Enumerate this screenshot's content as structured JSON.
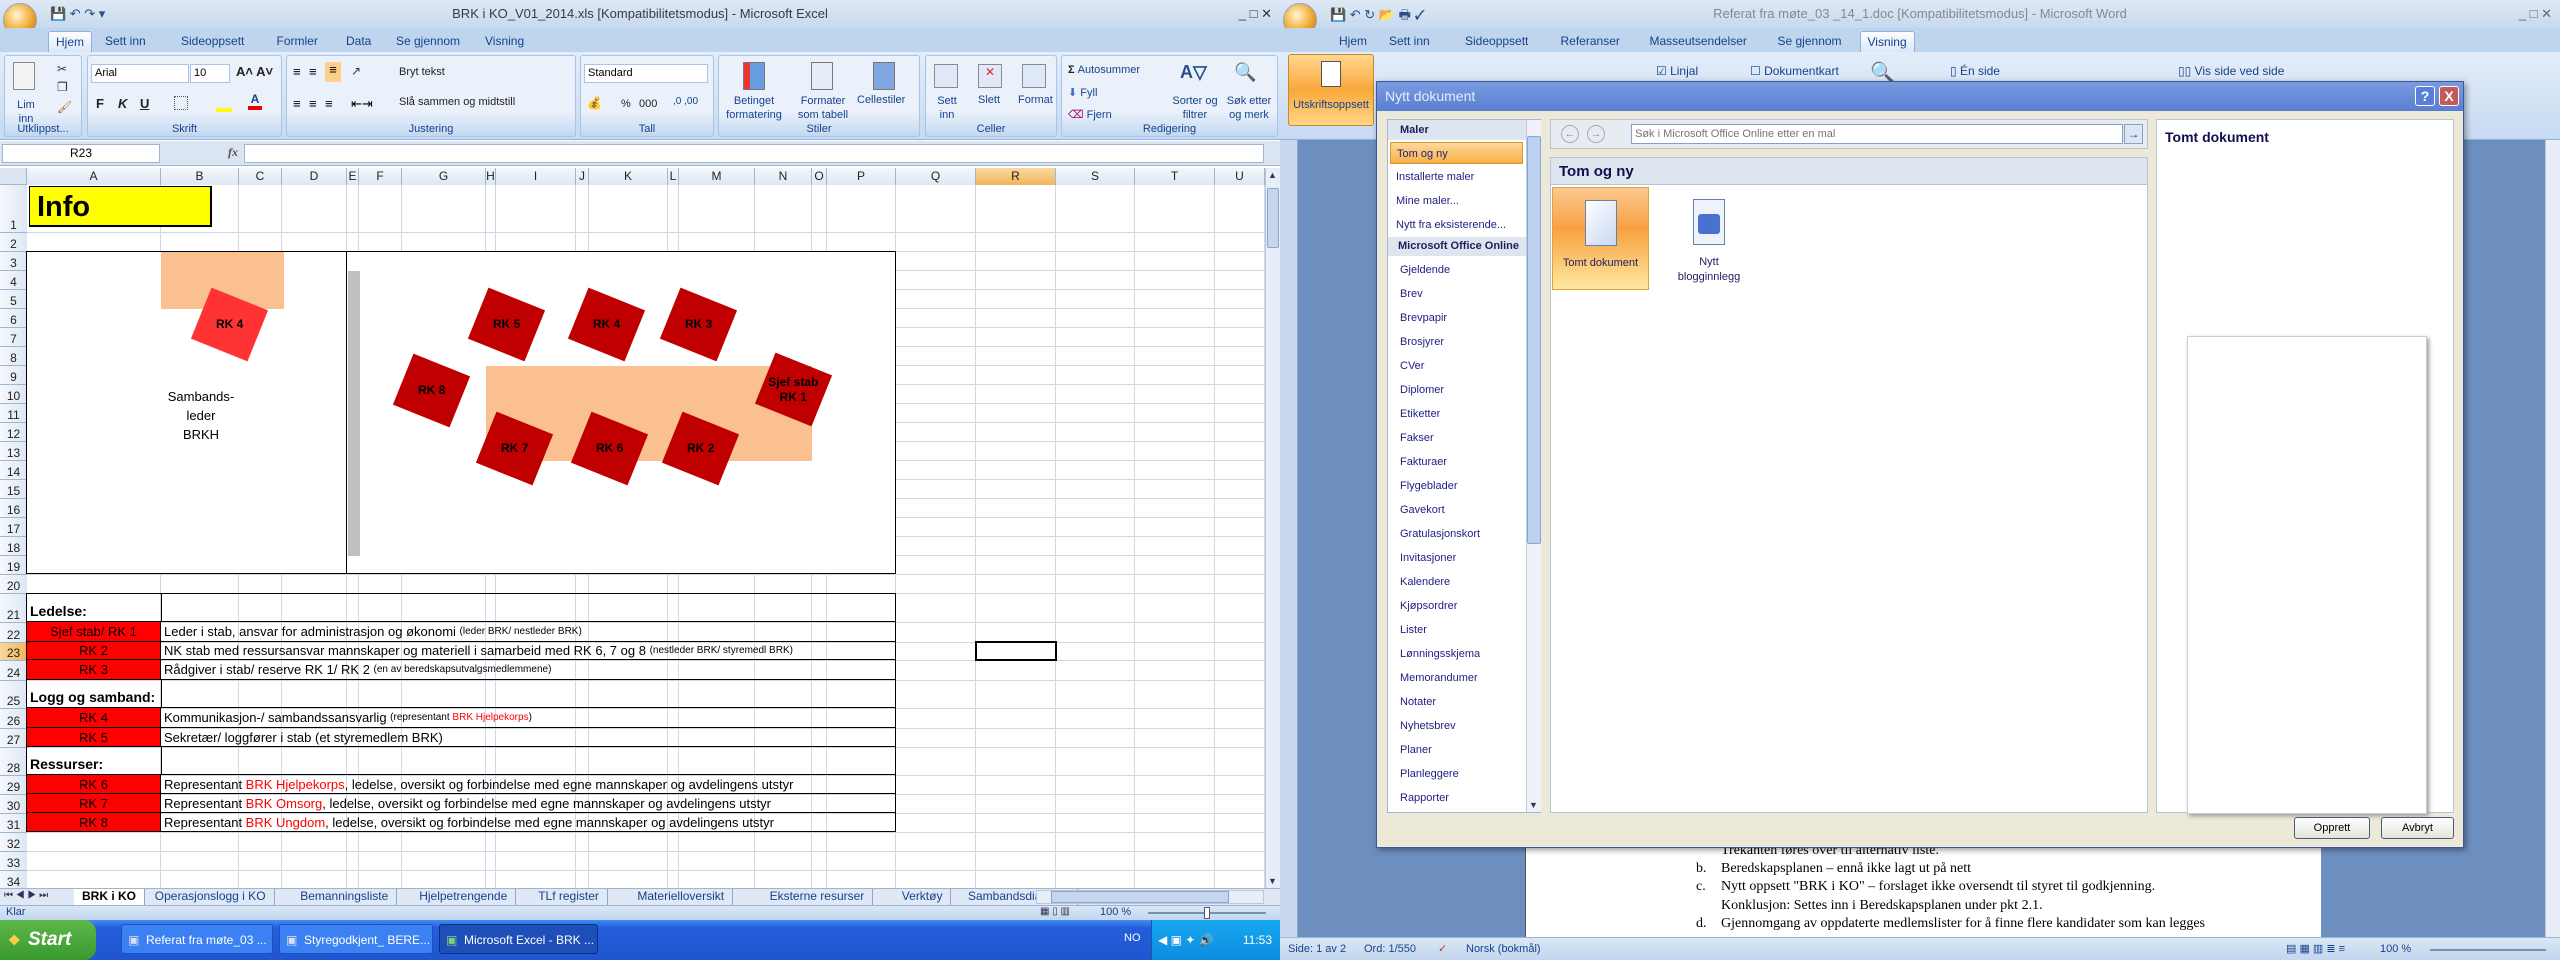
{
  "excel": {
    "title": "BRK i KO_V01_2014.xls  [Kompatibilitetsmodus] - Microsoft Excel",
    "tabs": [
      "Hjem",
      "Sett inn",
      "Sideoppsett",
      "Formler",
      "Data",
      "Se gjennom",
      "Visning"
    ],
    "active_tab": "Hjem",
    "ribbon": {
      "groups": [
        "Utklippst...",
        "Skrift",
        "Justering",
        "Tall",
        "Stiler",
        "Celler",
        "Redigering"
      ],
      "paste": "Lim inn",
      "font": "Arial",
      "size": "10",
      "bold": "F",
      "italic": "K",
      "underline": "U",
      "wrap": "Bryt tekst",
      "merge": "Slå sammen og midtstill",
      "number_format": "Standard",
      "percent": "%",
      "thousands": "000",
      "cond_format": "Betinget formatering",
      "format_table": "Formater som tabell",
      "cell_styles": "Cellestiler",
      "insert": "Sett inn",
      "delete": "Slett",
      "format": "Format",
      "autosum": "Autosummer",
      "fill": "Fyll",
      "clear": "Fjern",
      "sort": "Sorter og filtrer",
      "find": "Søk etter og merk"
    },
    "name_box": "R23",
    "fx": "fx",
    "formula": "",
    "columns": [
      "A",
      "B",
      "C",
      "D",
      "E",
      "F",
      "G",
      "H",
      "I",
      "J",
      "K",
      "L",
      "M",
      "N",
      "O",
      "P",
      "Q",
      "R",
      "S",
      "T",
      "U"
    ],
    "selected_cell": "R23",
    "info_title": "Info",
    "diagram": {
      "left_label": [
        "Sambands-",
        "leder",
        "BRKH"
      ],
      "left_seat": "RK 4",
      "seats": [
        "RK 5",
        "RK 4",
        "RK 3",
        "RK 8",
        "Sjef stab RK 1",
        "RK 7",
        "RK 6",
        "RK 2"
      ],
      "colors": {
        "seat": "#c00000",
        "seat_light": "#ff3333",
        "table": "#fac090",
        "wall": "#c0c0c0"
      }
    },
    "table": [
      {
        "row": 21,
        "header": "Ledelse:"
      },
      {
        "row": 22,
        "label": "Sjef stab/ RK 1",
        "parts": [
          [
            "Leder i stab, ansvar for administrasjon og økonomi ",
            "n"
          ],
          [
            "(leder BRK/ nestleder BRK)",
            "s"
          ]
        ]
      },
      {
        "row": 23,
        "label": "RK 2",
        "parts": [
          [
            "NK stab med ressursansvar mannskaper og materiell i samarbeid med RK 6, 7 og 8 ",
            "n"
          ],
          [
            "(nestleder BRK/ styremedl BRK)",
            "s"
          ]
        ]
      },
      {
        "row": 24,
        "label": "RK 3",
        "parts": [
          [
            "Rådgiver i stab/ reserve RK 1/ RK 2 ",
            "n"
          ],
          [
            "(en av beredskapsutvalgsmedlemmene)",
            "s"
          ]
        ]
      },
      {
        "row": 25,
        "header": "Logg og samband:"
      },
      {
        "row": 26,
        "label": "RK 4",
        "parts": [
          [
            "Kommunikasjon-/ sambandssansvarlig ",
            "n"
          ],
          [
            "(representant ",
            "s"
          ],
          [
            "BRK Hjelpekorps",
            "sr"
          ],
          [
            ")",
            "s"
          ]
        ]
      },
      {
        "row": 27,
        "label": "RK 5",
        "parts": [
          [
            "Sekretær/ loggfører i stab (et styremedlem BRK)",
            "n"
          ]
        ]
      },
      {
        "row": 28,
        "header": "Ressurser:"
      },
      {
        "row": 29,
        "label": "RK 6",
        "parts": [
          [
            "Representant ",
            "n"
          ],
          [
            "BRK Hjelpekorps",
            "r"
          ],
          [
            ", ledelse, oversikt og forbindelse med egne mannskaper og avdelingens utstyr",
            "n"
          ]
        ]
      },
      {
        "row": 30,
        "label": "RK 7",
        "parts": [
          [
            "Representant ",
            "n"
          ],
          [
            "BRK Omsorg",
            "r"
          ],
          [
            ", ledelse, oversikt og forbindelse med egne mannskaper og avdelingens utstyr",
            "n"
          ]
        ]
      },
      {
        "row": 31,
        "label": "RK 8",
        "parts": [
          [
            "Representant ",
            "n"
          ],
          [
            "BRK Ungdom",
            "r"
          ],
          [
            ", ledelse, oversikt og forbindelse med egne mannskaper og avdelingens utstyr",
            "n"
          ]
        ]
      }
    ],
    "sheet_tabs": [
      "BRK i KO",
      "Operasjonslogg i KO",
      "Bemanningsliste",
      "Hjelpetrengende",
      "TLf register",
      "Materielloversikt",
      "Eksterne resurser",
      "Verktøy",
      "Sambandsdiagram"
    ],
    "active_sheet": "BRK i KO",
    "status": "Klar",
    "zoom": "100 %"
  },
  "word": {
    "title": "Referat fra møte_03 _14_1.doc [Kompatibilitetsmodus] - Microsoft Word",
    "tabs": [
      "Hjem",
      "Sett inn",
      "Sideoppsett",
      "Referanser",
      "Masseutsendelser",
      "Se gjennom",
      "Visning"
    ],
    "active_tab": "Visning",
    "ribbon": {
      "print_layout": "Utskriftsoppsett",
      "ruler": "Linjal",
      "ruler_checked": true,
      "doc_map": "Dokumentkart",
      "doc_map_checked": false,
      "one_page": "Én side",
      "side_by_side": "Vis side ved side"
    },
    "doc_lines": [
      {
        "marker": "",
        "text": "Trekanten føres over til alternativ liste."
      },
      {
        "marker": "b.",
        "text": "Beredskapsplanen – ennå ikke lagt ut på nett"
      },
      {
        "marker": "c.",
        "text": "Nytt oppsett \"BRK i KO\" – forslaget ikke oversendt til styret til godkjenning."
      },
      {
        "marker": "",
        "text": "Konklusjon: Settes inn i Beredskapsplanen under pkt 2.1."
      },
      {
        "marker": "d.",
        "text": "Gjennomgang av oppdaterte medlemslister for å finne flere kandidater som kan legges"
      }
    ],
    "status": {
      "page": "Side: 1 av 2",
      "words": "Ord: 1/550",
      "language": "Norsk (bokmål)",
      "zoom": "100 %"
    }
  },
  "dialog": {
    "title": "Nytt dokument",
    "help": "?",
    "close": "X",
    "templates_header": "Maler",
    "selected": "Tom og ny",
    "items_top": [
      "Tom og ny",
      "Installerte maler",
      "Mine maler...",
      "Nytt fra eksisterende..."
    ],
    "online_header": "Microsoft Office Online",
    "items_online": [
      "Gjeldende",
      "Brev",
      "Brevpapir",
      "Brosjyrer",
      "CVer",
      "Diplomer",
      "Etiketter",
      "Fakser",
      "Fakturaer",
      "Flygeblader",
      "Gavekort",
      "Gratulasjonskort",
      "Invitasjoner",
      "Kalendere",
      "Kjøpsordrer",
      "Lister",
      "Lønningsskjema",
      "Memorandumer",
      "Notater",
      "Nyhetsbrev",
      "Planer",
      "Planleggere",
      "Rapporter"
    ],
    "search_placeholder": "Søk i Microsoft Office Online etter en mal",
    "section_title": "Tom og ny",
    "tiles": [
      "Tomt dokument",
      "Nytt blogginnlegg"
    ],
    "preview_title": "Tomt dokument",
    "create": "Opprett",
    "cancel": "Avbryt"
  },
  "taskbar": {
    "start": "Start",
    "tasks": [
      "Referat fra møte_03 ...",
      "Styregodkjent_ BERE...",
      "Microsoft Excel - BRK ..."
    ],
    "active_task": 2,
    "tray_text": "NO",
    "clock": "11:53"
  }
}
